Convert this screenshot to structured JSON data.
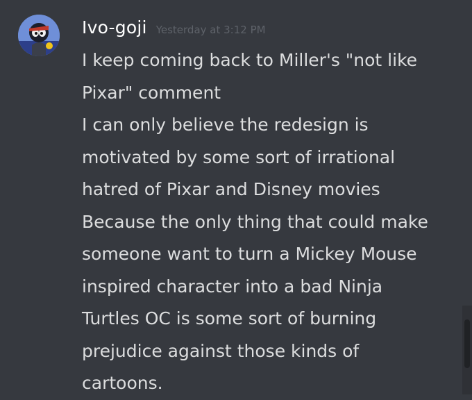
{
  "message": {
    "author": "Ivo-goji",
    "timestamp": "Yesterday at 3:12 PM",
    "avatar_icon": "user-avatar-icon",
    "lines": [
      "I keep coming back to Miller's \"not like",
      "Pixar\" comment",
      "I can only believe the redesign is",
      "motivated by some sort of irrational",
      "hatred of Pixar and Disney movies",
      "Because the only thing that could make",
      "someone want to turn a Mickey Mouse",
      "inspired character into a bad Ninja",
      "Turtles OC is some sort of burning",
      "prejudice against those kinds of",
      "cartoons."
    ]
  },
  "colors": {
    "background": "#36393f",
    "username": "#ffffff",
    "timestamp": "#5e6269",
    "message_text": "#dcddde"
  }
}
